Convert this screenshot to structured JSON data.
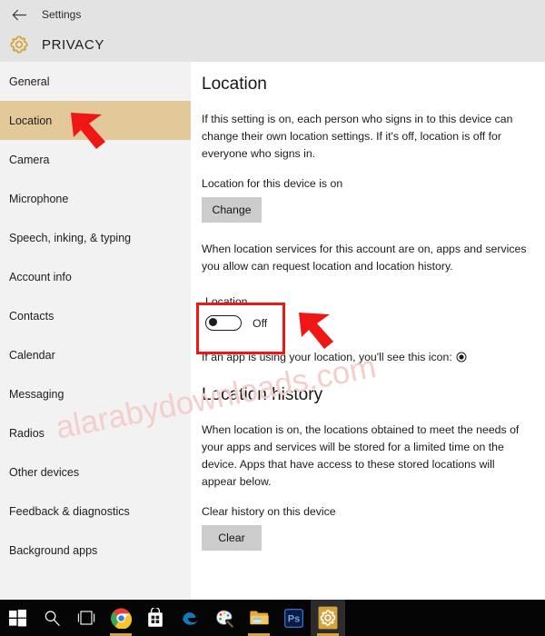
{
  "header": {
    "back_icon": "back-arrow-icon",
    "back_label": "Settings",
    "gear_icon": "gear-icon",
    "title": "PRIVACY"
  },
  "sidebar": {
    "items": [
      {
        "label": "General",
        "selected": false
      },
      {
        "label": "Location",
        "selected": true
      },
      {
        "label": "Camera",
        "selected": false
      },
      {
        "label": "Microphone",
        "selected": false
      },
      {
        "label": "Speech, inking, & typing",
        "selected": false
      },
      {
        "label": "Account info",
        "selected": false
      },
      {
        "label": "Contacts",
        "selected": false
      },
      {
        "label": "Calendar",
        "selected": false
      },
      {
        "label": "Messaging",
        "selected": false
      },
      {
        "label": "Radios",
        "selected": false
      },
      {
        "label": "Other devices",
        "selected": false
      },
      {
        "label": "Feedback & diagnostics",
        "selected": false
      },
      {
        "label": "Background apps",
        "selected": false
      }
    ]
  },
  "content": {
    "location": {
      "heading": "Location",
      "description": "If this setting is on, each person who signs in to this device can change their own location settings. If it's off, location is off for everyone who signs in.",
      "device_status": "Location for this device is on",
      "change_button": "Change",
      "services_description": "When location services for this account are on, apps and services you allow can request location and location history.",
      "toggle_caption": "Location",
      "toggle_state": "Off",
      "icon_note": "If an app is using your location, you'll see this icon:",
      "icon_note_glyph": "location-indicator-icon"
    },
    "history": {
      "heading": "Location history",
      "description": "When location is on, the locations obtained to meet the needs of your apps and services will be stored for a limited time on the device. Apps that have access to these stored locations will appear below.",
      "clear_label": "Clear history on this device",
      "clear_button": "Clear"
    }
  },
  "annotations": {
    "watermark": "alarabydownloads.com",
    "highlight_color": "#ef1616",
    "arrow_color": "#ef1616",
    "arrows": [
      "arrow-pointing-at-location-nav",
      "arrow-pointing-at-location-toggle"
    ]
  },
  "taskbar": {
    "items": [
      {
        "name": "start-button-icon",
        "running": false
      },
      {
        "name": "search-icon",
        "running": false
      },
      {
        "name": "task-view-icon",
        "running": false
      },
      {
        "name": "chrome-icon",
        "running": true
      },
      {
        "name": "microsoft-store-icon",
        "running": false
      },
      {
        "name": "edge-icon",
        "running": false
      },
      {
        "name": "paint-icon",
        "running": false
      },
      {
        "name": "file-explorer-icon",
        "running": true
      },
      {
        "name": "photoshop-icon",
        "running": false
      },
      {
        "name": "settings-icon",
        "running": true
      }
    ]
  },
  "theme": {
    "header_bg": "#e3e3e3",
    "sidebar_bg": "#f2f2f2",
    "selection_bg": "#e3c89a",
    "accent_gold": "#d6a23a",
    "button_bg": "#cccccc",
    "taskbar_bg": "#050505"
  }
}
